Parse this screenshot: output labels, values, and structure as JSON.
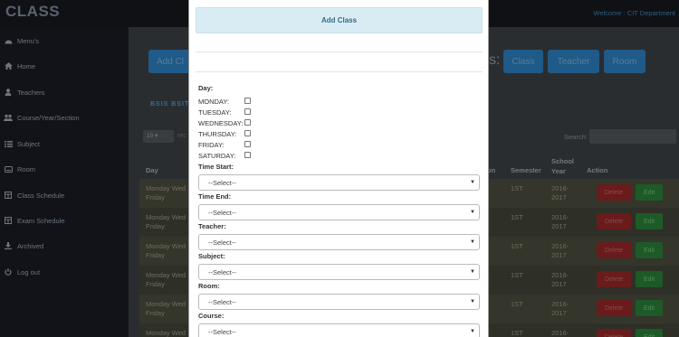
{
  "app": {
    "brand": "CLASS",
    "welcome": "Welcome : CIT Department"
  },
  "sidebar": {
    "items": [
      {
        "label": "Menu's",
        "icon": "dashboard-icon"
      },
      {
        "label": "Home",
        "icon": "home-icon"
      },
      {
        "label": "Teachers",
        "icon": "user-icon"
      },
      {
        "label": "Course/Year/Section",
        "icon": "users-icon"
      },
      {
        "label": "Subject",
        "icon": "list-icon"
      },
      {
        "label": "Room",
        "icon": "room-icon"
      },
      {
        "label": "Class Schedule",
        "icon": "calendar-icon"
      },
      {
        "label": "Exam Schedule",
        "icon": "calendar-icon"
      },
      {
        "label": "Archived",
        "icon": "download-icon"
      },
      {
        "label": "Log out",
        "icon": "power-icon"
      }
    ]
  },
  "main": {
    "add_button": "Add Cl",
    "heading_fragment": "s:",
    "filters": {
      "class": "Class",
      "teacher": "Teacher",
      "room": "Room"
    },
    "tabs": "BSIS  BSIT",
    "length_value": "10",
    "length_suffix": "rec",
    "search_label": "Search:",
    "columns": {
      "day": "Day",
      "section": "on",
      "semester": "Semester",
      "school_year": "School Year",
      "action": "Action"
    },
    "rows": [
      {
        "day": "Monday Wed Friday",
        "semester": "1ST",
        "year": "2016-2017"
      },
      {
        "day": "Monday Wed Friday",
        "semester": "1ST",
        "year": "2016-2017"
      },
      {
        "day": "Monday Wed Friday",
        "semester": "1ST",
        "year": "2016-2017"
      },
      {
        "day": "Monday Wed Friday",
        "semester": "1ST",
        "year": "2016-2017"
      },
      {
        "day": "Monday Wed Friday",
        "semester": "1ST",
        "year": "2016-2017"
      },
      {
        "day": "Monday Wed",
        "semester": "1ST",
        "year": "2016-"
      }
    ],
    "delete_label": "Delete",
    "edit_label": "Edit"
  },
  "modal": {
    "title": "Add Class",
    "day_label": "Day:",
    "days": [
      "MONDAY:",
      "TUESDAY:",
      "WEDNESDAY:",
      "THURSDAY:",
      "FRIDAY:",
      "SATURDAY:"
    ],
    "fields": [
      {
        "label": "Time Start:",
        "value": "--Select--"
      },
      {
        "label": "Time End:",
        "value": "--Select--"
      },
      {
        "label": "Teacher:",
        "value": "--Select--"
      },
      {
        "label": "Subject:",
        "value": "--Select--"
      },
      {
        "label": "Room:",
        "value": "--Select--"
      },
      {
        "label": "Course:",
        "value": "--Select--"
      }
    ]
  },
  "colors": {
    "primary": "#337ab7",
    "danger": "#c9302c",
    "success": "#449d44",
    "modal_header": "#d9edf7"
  }
}
